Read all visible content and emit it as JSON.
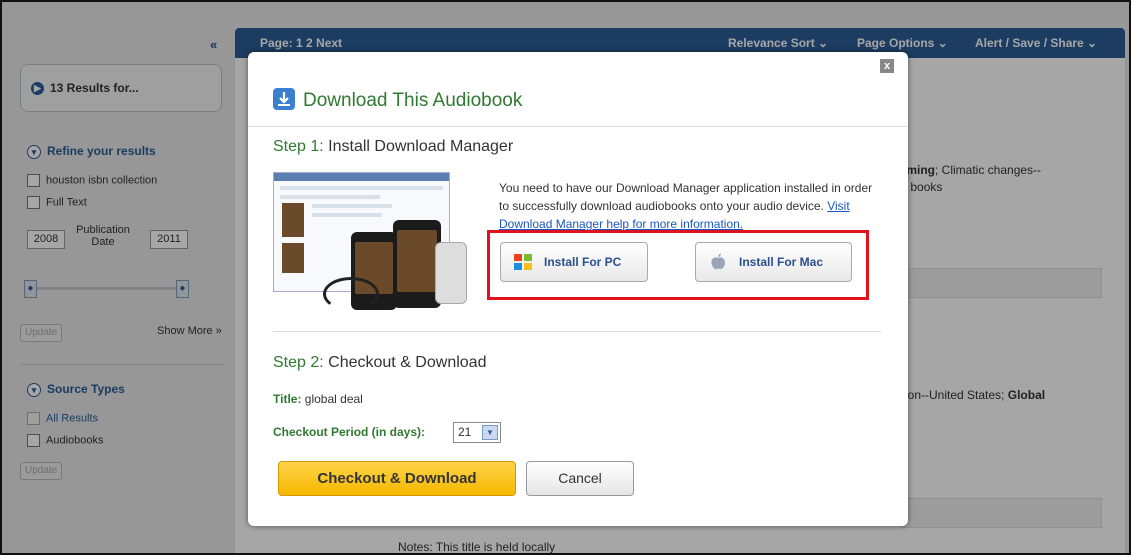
{
  "sidebar": {
    "collapse": "«",
    "results_label": "13 Results for...",
    "refine_title": "Refine your results",
    "filters": [
      "houston isbn collection",
      "Full Text"
    ],
    "date_from": "2008",
    "date_to": "2011",
    "date_label": "Publication Date",
    "update_label": "Update",
    "show_more": "Show More »",
    "source_title": "Source Types",
    "sources": [
      "All Results",
      "Audiobooks"
    ],
    "update_label_2": "Update"
  },
  "topbar": {
    "pages": "Page: 1 2 Next",
    "relevance": "Relevance Sort ⌄",
    "page_options": "Page Options ⌄",
    "alert": "Alert / Save / Share ⌄"
  },
  "background": {
    "line1_bold": "arming",
    "line1_rest": "; Climatic changes--",
    "line2": "lio books",
    "line3_rest": "ation--United States; ",
    "line3_bold": "Global",
    "notes": "Notes:  This title is held locally"
  },
  "modal": {
    "close": "x",
    "title": "Download This Audiobook",
    "step1_num": "Step 1:",
    "step1_text": " Install Download Manager",
    "desc": "You need to have our Download Manager application installed in order to successfully download audiobooks onto your audio device. ",
    "desc_link": "Visit Download Manager help for more information.",
    "install_pc": "Install For PC",
    "install_mac": "Install For Mac",
    "step2_num": "Step 2:",
    "step2_text": " Checkout & Download",
    "title_key": "Title:",
    "title_value": " global deal",
    "period_key": "Checkout Period (in days):",
    "period_value": "21",
    "checkout_btn": "Checkout & Download",
    "cancel_btn": "Cancel"
  },
  "colors": {
    "accent_green": "#2f7a31",
    "topbar_blue": "#2b5f96",
    "highlight_red": "#e0121e",
    "checkout_yellow": "#f5b800"
  },
  "icons": [
    "download-icon",
    "windows-icon",
    "apple-icon",
    "close-icon",
    "chevron-down-icon"
  ]
}
